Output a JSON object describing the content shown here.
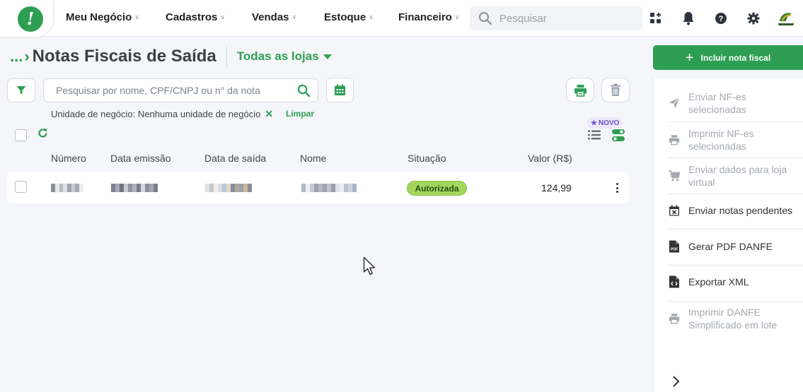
{
  "header": {
    "logo_glyph": "!",
    "nav": [
      {
        "label": "Meu Negócio"
      },
      {
        "label": "Cadastros"
      },
      {
        "label": "Vendas"
      },
      {
        "label": "Estoque"
      },
      {
        "label": "Financeiro"
      }
    ],
    "search_placeholder": "Pesquisar",
    "icons": [
      "apps-icon",
      "bell-icon",
      "help-icon",
      "gear-icon"
    ]
  },
  "page": {
    "breadcrumb_dots": "...",
    "title": "Notas Fiscais de Saída",
    "store_selector": "Todas as lojas"
  },
  "filters": {
    "search_placeholder": "Pesquisar por nome, CPF/CNPJ ou n° da nota",
    "active_filter": "Unidade de negócio: Nenhuma unidade de negócio",
    "clear_label": "Limpar",
    "new_badge": "NOVO"
  },
  "table": {
    "columns": [
      "Número",
      "Data emissão",
      "Data de saída",
      "Nome",
      "Situação",
      "Valor (R$)"
    ],
    "rows": [
      {
        "status": "Autorizada",
        "value": "124,99"
      }
    ]
  },
  "side_panel": {
    "primary_action": "Incluir nota fiscal",
    "actions": [
      {
        "label": "Enviar NF-es selecionadas",
        "enabled": false,
        "icon": "send-icon"
      },
      {
        "label": "Imprimir NF-es selecionadas",
        "enabled": false,
        "icon": "printer-icon"
      },
      {
        "label": "Enviar dados para loja virtual",
        "enabled": false,
        "icon": "cart-icon"
      },
      {
        "label": "Enviar notas pendentes",
        "enabled": true,
        "icon": "calendar-x-icon"
      },
      {
        "label": "Gerar PDF DANFE",
        "enabled": true,
        "icon": "pdf-file-icon"
      },
      {
        "label": "Exportar XML",
        "enabled": true,
        "icon": "code-file-icon"
      },
      {
        "label": "Imprimir DANFE Simplificado em lote",
        "enabled": false,
        "icon": "printer-icon"
      }
    ]
  },
  "colors": {
    "accent": "#2e9e52",
    "status_authorized": "#a4d65e",
    "disabled_text": "#a4a9b0"
  }
}
